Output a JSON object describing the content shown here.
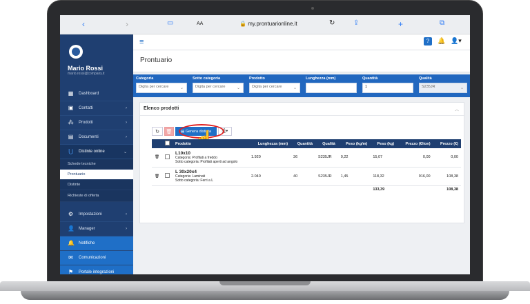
{
  "browser": {
    "url": "my.prontuarionline.it",
    "aa_label": "AA"
  },
  "user": {
    "name": "Mario Rossi",
    "email": "mario.rossi@company.it"
  },
  "sidebar": {
    "items": [
      {
        "label": "Dashboard"
      },
      {
        "label": "Contatti"
      },
      {
        "label": "Prodotti"
      },
      {
        "label": "Documenti"
      },
      {
        "label": "Distinte online"
      }
    ],
    "sub_items": [
      {
        "label": "Schede tecniche"
      },
      {
        "label": "Prontuario"
      },
      {
        "label": "Distinte"
      },
      {
        "label": "Richieste di offerta"
      }
    ],
    "bottom_items": [
      {
        "label": "Impostazioni"
      },
      {
        "label": "Manager"
      },
      {
        "label": "Notifiche"
      },
      {
        "label": "Comunicazioni"
      },
      {
        "label": "Portale integrazioni"
      }
    ]
  },
  "page": {
    "title": "Prontuario"
  },
  "filters": {
    "categoria": {
      "label": "Categoria",
      "placeholder": "Digita per cercare"
    },
    "sotto_categoria": {
      "label": "Sotto categoria",
      "placeholder": "Digita per cercare"
    },
    "prodotto": {
      "label": "Prodotto",
      "placeholder": "Digita per cercare"
    },
    "lunghezza": {
      "label": "Lunghezza (mm)",
      "value": ""
    },
    "quantita": {
      "label": "Quantità",
      "value": "1"
    },
    "qualita": {
      "label": "Qualità",
      "value": "S235JR"
    }
  },
  "panel": {
    "title": "Elenco prodotti",
    "generate_label": "Genera distinta"
  },
  "table": {
    "headers": [
      "Prodotto",
      "Lunghezza (mm)",
      "Quantità",
      "Qualità",
      "Peso (kg/m)",
      "Peso (kg)",
      "Prezzo (€/ton)",
      "Prezzo (€)"
    ],
    "rows": [
      {
        "name": "L10x10",
        "categoria": "Categoria: Profilati a freddo",
        "sotto": "Sotto categoria: Profilati aperti ad angolo",
        "lunghezza": "1.920",
        "quantita": "36",
        "qualita": "S235JR",
        "peso_kgm": "0,22",
        "peso_kg": "15,07",
        "prezzo_ton": "0,00",
        "prezzo": "0,00"
      },
      {
        "name": "L 30x20x4",
        "categoria": "Categoria: Laminati",
        "sotto": "Sotto categoria: Ferri a L",
        "lunghezza": "2.040",
        "quantita": "40",
        "qualita": "S235JR",
        "peso_kgm": "1,45",
        "peso_kg": "118,32",
        "prezzo_ton": "916,00",
        "prezzo": "108,38"
      }
    ],
    "totals": {
      "peso_kg": "133,39",
      "prezzo": "108,38"
    }
  }
}
